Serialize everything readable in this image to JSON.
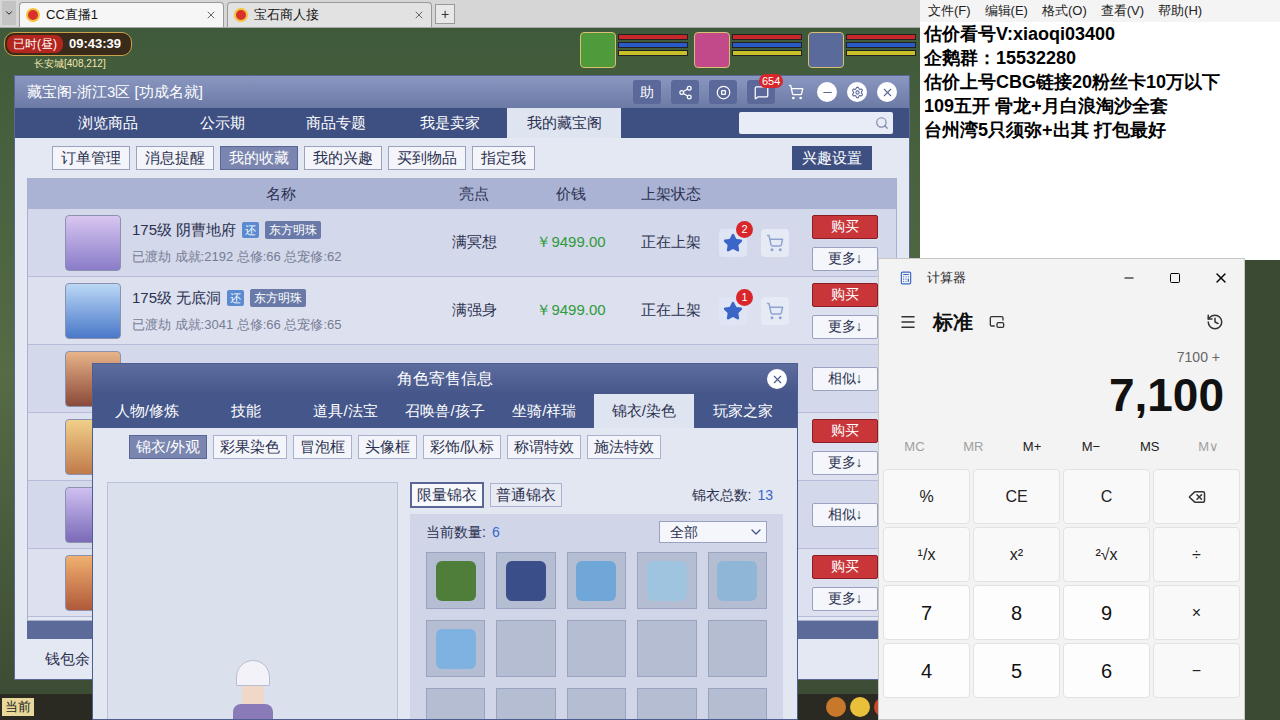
{
  "browser": {
    "tabs": [
      {
        "label": "CC直播1",
        "selected": true
      },
      {
        "label": "宝石商人接",
        "selected": false
      }
    ],
    "new_tab": "+"
  },
  "hud": {
    "time_label": "已时(昼)",
    "clock": "09:43:39",
    "location": "长安城[408,212]"
  },
  "cbg": {
    "title": "藏宝阁-浙江3区 [功成名就]",
    "help": "助",
    "message_count": "654",
    "tabs": [
      {
        "label": "浏览商品",
        "selected": false
      },
      {
        "label": "公示期",
        "selected": false
      },
      {
        "label": "商品专题",
        "selected": false
      },
      {
        "label": "我是卖家",
        "selected": false
      },
      {
        "label": "我的藏宝阁",
        "selected": true
      }
    ],
    "subtabs": [
      {
        "label": "订单管理",
        "selected": false
      },
      {
        "label": "消息提醒",
        "selected": false
      },
      {
        "label": "我的收藏",
        "selected": true
      },
      {
        "label": "我的兴趣",
        "selected": false
      },
      {
        "label": "买到物品",
        "selected": false
      },
      {
        "label": "指定我",
        "selected": false
      }
    ],
    "interest_settings": "兴趣设置",
    "columns": [
      "名称",
      "亮点",
      "价钱",
      "上架状态"
    ],
    "rows": [
      {
        "name": "175级 阴曹地府",
        "tag": "还",
        "server": "东方明珠",
        "details": "已渡劫 成就:2192 总修:66 总宠修:62",
        "highlight": "满冥想",
        "price": "￥9499.00",
        "status": "正在上架",
        "favorites": "2",
        "actions": [
          {
            "label": "购买",
            "kind": "buy"
          },
          {
            "label": "更多↓",
            "kind": "more"
          }
        ]
      },
      {
        "name": "175级 无底洞",
        "tag": "还",
        "server": "东方明珠",
        "details": "已渡劫 成就:3041 总修:66 总宠修:65",
        "highlight": "满强身",
        "price": "￥9499.00",
        "status": "正在上架",
        "favorites": "1",
        "actions": [
          {
            "label": "购买",
            "kind": "buy"
          },
          {
            "label": "更多↓",
            "kind": "more"
          }
        ]
      },
      {
        "actions": [
          {
            "label": "相似↓",
            "kind": "more"
          }
        ]
      },
      {
        "actions": [
          {
            "label": "购买",
            "kind": "buy"
          },
          {
            "label": "更多↓",
            "kind": "more"
          }
        ]
      },
      {
        "actions": [
          {
            "label": "相似↓",
            "kind": "more"
          }
        ]
      },
      {
        "actions": [
          {
            "label": "购买",
            "kind": "buy"
          },
          {
            "label": "更多↓",
            "kind": "more"
          }
        ]
      }
    ],
    "wallet": "钱包余",
    "chat_channel": "当前"
  },
  "dialog": {
    "title": "角色寄售信息",
    "tabs": [
      {
        "label": "人物/修炼",
        "selected": false
      },
      {
        "label": "技能",
        "selected": false
      },
      {
        "label": "道具/法宝",
        "selected": false
      },
      {
        "label": "召唤兽/孩子",
        "selected": false
      },
      {
        "label": "坐骑/祥瑞",
        "selected": false
      },
      {
        "label": "锦衣/染色",
        "selected": true
      },
      {
        "label": "玩家之家",
        "selected": false
      }
    ],
    "subtabs": [
      {
        "label": "锦衣/外观",
        "selected": true
      },
      {
        "label": "彩果染色",
        "selected": false
      },
      {
        "label": "冒泡框",
        "selected": false
      },
      {
        "label": "头像框",
        "selected": false
      },
      {
        "label": "彩饰/队标",
        "selected": false
      },
      {
        "label": "称谓特效",
        "selected": false
      },
      {
        "label": "施法特效",
        "selected": false
      }
    ],
    "outfit_types": [
      {
        "label": "限量锦衣",
        "selected": true
      },
      {
        "label": "普通锦衣",
        "selected": false
      }
    ],
    "total_label": "锦衣总数:",
    "total": "13",
    "count_label": "当前数量:",
    "count": "6",
    "filter": "全部",
    "slots": [
      {
        "filled": true,
        "color": "#4f7d3a"
      },
      {
        "filled": true,
        "color": "#3a4f8a"
      },
      {
        "filled": true,
        "color": "#6fa8d8"
      },
      {
        "filled": true,
        "color": "#9fc4e0"
      },
      {
        "filled": true,
        "color": "#8fb6d6"
      },
      {
        "filled": true,
        "color": "#7fb2e0"
      },
      {
        "filled": false,
        "color": "#aab3c9"
      },
      {
        "filled": false,
        "color": "#aab3c9"
      },
      {
        "filled": false,
        "color": "#aab3c9"
      },
      {
        "filled": false,
        "color": "#aab3c9"
      },
      {
        "filled": false,
        "color": "#aab3c9"
      },
      {
        "filled": false,
        "color": "#aab3c9"
      },
      {
        "filled": false,
        "color": "#aab3c9"
      },
      {
        "filled": false,
        "color": "#aab3c9"
      },
      {
        "filled": false,
        "color": "#aab3c9"
      }
    ]
  },
  "notepad": {
    "menu": [
      "文件(F)",
      "编辑(E)",
      "格式(O)",
      "查看(V)",
      "帮助(H)"
    ],
    "lines": [
      "估价看号V:xiaoqi03400",
      "企鹅群：15532280",
      "估价上号CBG链接20粉丝卡10万以下",
      "109五开 骨龙+月白浪淘沙全套",
      "台州湾5只须弥+出其 打包最好"
    ]
  },
  "calculator": {
    "title": "计算器",
    "mode": "标准",
    "expression": "7100 +",
    "display": "7,100",
    "memory": [
      {
        "label": "MC",
        "disabled": true
      },
      {
        "label": "MR",
        "disabled": true
      },
      {
        "label": "M+",
        "disabled": false
      },
      {
        "label": "M−",
        "disabled": false
      },
      {
        "label": "MS",
        "disabled": false
      },
      {
        "label": "M∨",
        "disabled": true
      }
    ],
    "keys": [
      {
        "label": "%",
        "kind": "function"
      },
      {
        "label": "CE",
        "kind": "function"
      },
      {
        "label": "C",
        "kind": "function"
      },
      {
        "label": "",
        "kind": "backspace"
      },
      {
        "label": "¹/x",
        "kind": "function"
      },
      {
        "label": "x²",
        "kind": "function"
      },
      {
        "label": "²√x",
        "kind": "function"
      },
      {
        "label": "÷",
        "kind": "function"
      },
      {
        "label": "7",
        "kind": "digit"
      },
      {
        "label": "8",
        "kind": "digit"
      },
      {
        "label": "9",
        "kind": "digit"
      },
      {
        "label": "×",
        "kind": "function"
      },
      {
        "label": "4",
        "kind": "digit"
      },
      {
        "label": "5",
        "kind": "digit"
      },
      {
        "label": "6",
        "kind": "digit"
      },
      {
        "label": "−",
        "kind": "function"
      }
    ]
  }
}
